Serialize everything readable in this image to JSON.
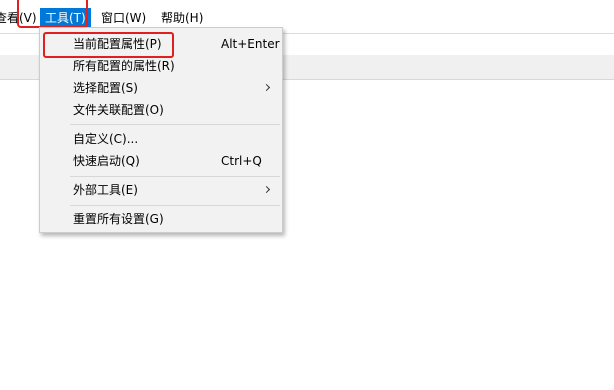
{
  "menubar": {
    "view_label": "查看(V)",
    "tools_label": "工具(T)",
    "window_label": "窗口(W)",
    "help_label": "帮助(H)"
  },
  "tools_menu": {
    "items": [
      {
        "label": "当前配置属性(P)",
        "shortcut": "Alt+Enter"
      },
      {
        "label": "所有配置的属性(R)"
      },
      {
        "label": "选择配置(S)"
      },
      {
        "label": "文件关联配置(O)"
      },
      {
        "label": "自定义(C)..."
      },
      {
        "label": "快速启动(Q)",
        "shortcut": "Ctrl+Q"
      },
      {
        "label": "外部工具(E)"
      },
      {
        "label": "重置所有设置(G)"
      }
    ]
  },
  "colors": {
    "menu_highlight": "#0078d7",
    "annotation_red": "#e02020",
    "dropdown_bg": "#f2f2f2"
  }
}
